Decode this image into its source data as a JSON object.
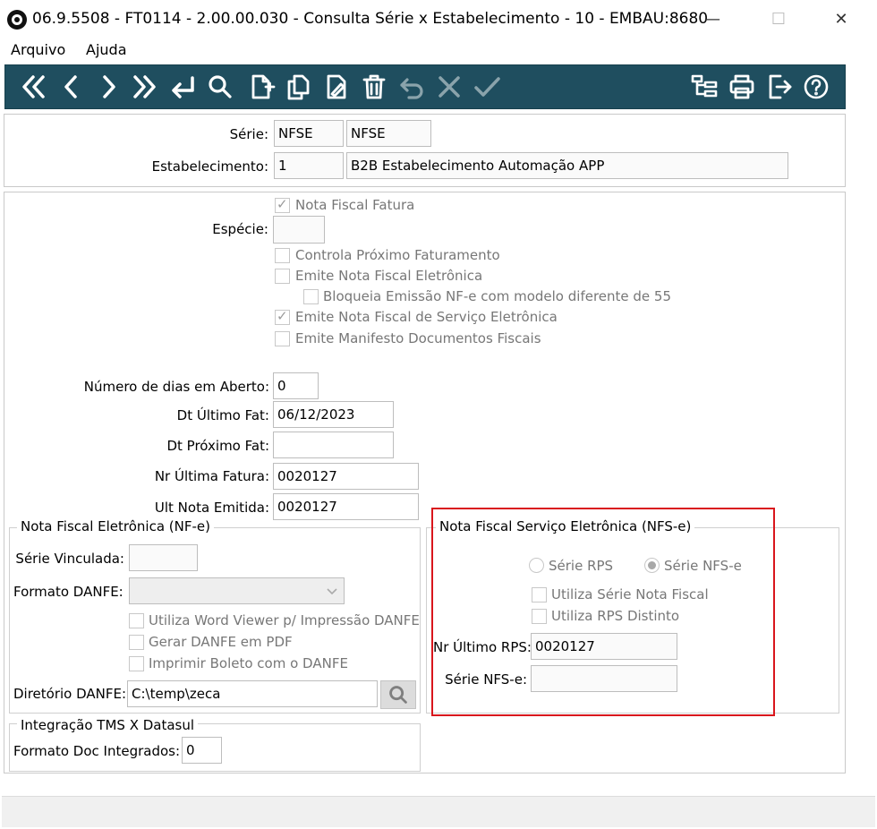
{
  "window": {
    "title": "06.9.5508 - FT0114 - 2.00.00.030 - Consulta Série x Estabelecimento - 10 - EMBAU:8680",
    "minimize": "—",
    "maximize": "☐",
    "close": "✕"
  },
  "menu": {
    "file": "Arquivo",
    "help": "Ajuda"
  },
  "toolbar": {
    "accent": "#1f4e5f",
    "buttons": [
      "first",
      "previous",
      "next",
      "last",
      "goto",
      "search",
      "new",
      "copy",
      "edit",
      "delete",
      "undo",
      "cancel",
      "confirm",
      "navigator",
      "print",
      "exit",
      "help"
    ]
  },
  "header": {
    "serie_label": "Série:",
    "serie_code": "NFSE",
    "serie_desc": "NFSE",
    "estab_label": "Estabelecimento:",
    "estab_code": "1",
    "estab_desc": "B2B  Estabelecimento Automação APP"
  },
  "main": {
    "nota_fiscal_fatura": "Nota Fiscal Fatura",
    "especie_label": "Espécie:",
    "especie_value": "",
    "checks": {
      "controla": "Controla Próximo Faturamento",
      "emite_nfe": "Emite Nota Fiscal Eletrônica",
      "bloqueia": "Bloqueia Emissão NF-e com modelo diferente de 55",
      "emite_nfse": "Emite Nota Fiscal de Serviço Eletrônica",
      "emite_mdfe": "Emite Manifesto Documentos Fiscais"
    },
    "dias_label": "Número de dias em Aberto:",
    "dias_value": "0",
    "dt_ultimo_label": "Dt Último Fat:",
    "dt_ultimo_value": "06/12/2023",
    "dt_proximo_label": "Dt Próximo Fat:",
    "dt_proximo_value": "",
    "nr_ultima_label": "Nr Última Fatura:",
    "nr_ultima_value": "0020127",
    "ult_nota_label": "Ult Nota Emitida:",
    "ult_nota_value": "0020127"
  },
  "nfe": {
    "title": "Nota Fiscal Eletrônica (NF-e)",
    "serie_vinc_label": "Série Vinculada:",
    "serie_vinc_value": "",
    "formato_label": "Formato DANFE:",
    "formato_value": "",
    "utiliza_word": "Utiliza Word Viewer p/ Impressão DANFE",
    "gerar_pdf": "Gerar DANFE em PDF",
    "imprimir_boleto": "Imprimir Boleto com o DANFE",
    "diretorio_label": "Diretório DANFE:",
    "diretorio_value": "C:\\temp\\zeca"
  },
  "tms": {
    "title": "Integração TMS X Datasul",
    "formato_label": "Formato Doc Integrados:",
    "formato_value": "0"
  },
  "nfse": {
    "title": "Nota Fiscal Serviço Eletrônica (NFS-e)",
    "radio_rps": "Série RPS",
    "radio_nfse": "Série NFS-e",
    "utiliza_serie": "Utiliza Série Nota Fiscal",
    "utiliza_rps": "Utiliza RPS Distinto",
    "nr_rps_label": "Nr Último RPS:",
    "nr_rps_value": "0020127",
    "serie_nfse_label": "Série NFS-e:",
    "serie_nfse_value": "",
    "highlight_color": "#d9161c"
  }
}
